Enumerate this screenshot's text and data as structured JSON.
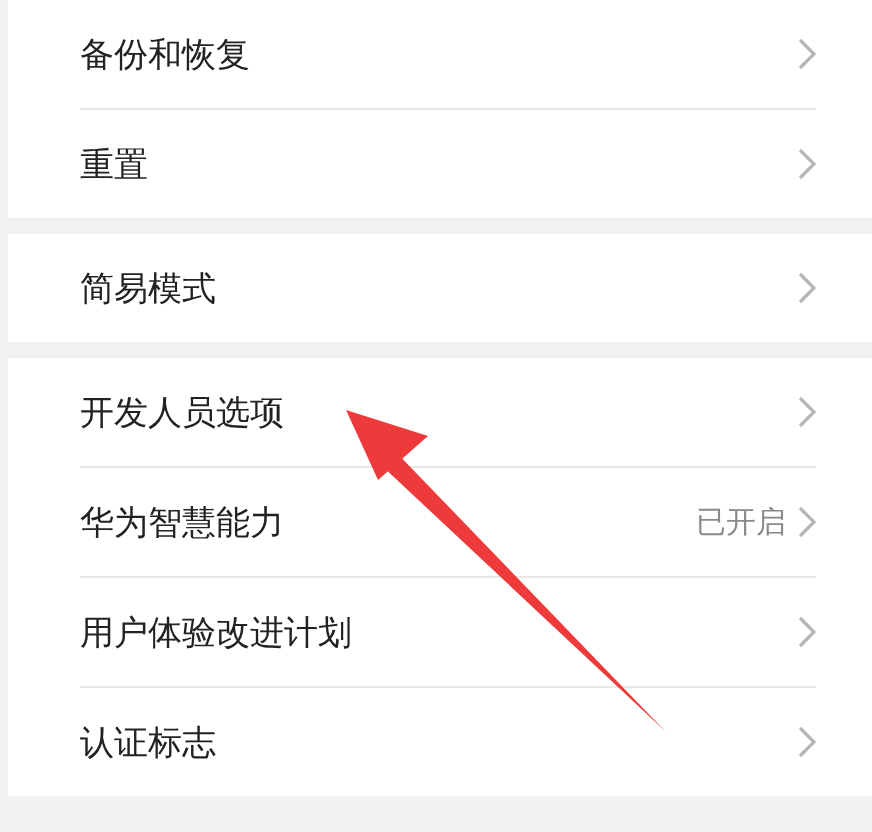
{
  "groups": [
    {
      "items": [
        {
          "label": "备份和恢复"
        },
        {
          "label": "重置"
        }
      ]
    },
    {
      "items": [
        {
          "label": "简易模式"
        }
      ]
    },
    {
      "items": [
        {
          "label": "开发人员选项"
        },
        {
          "label": "华为智慧能力",
          "value": "已开启"
        },
        {
          "label": "用户体验改进计划"
        },
        {
          "label": "认证标志"
        }
      ]
    }
  ]
}
